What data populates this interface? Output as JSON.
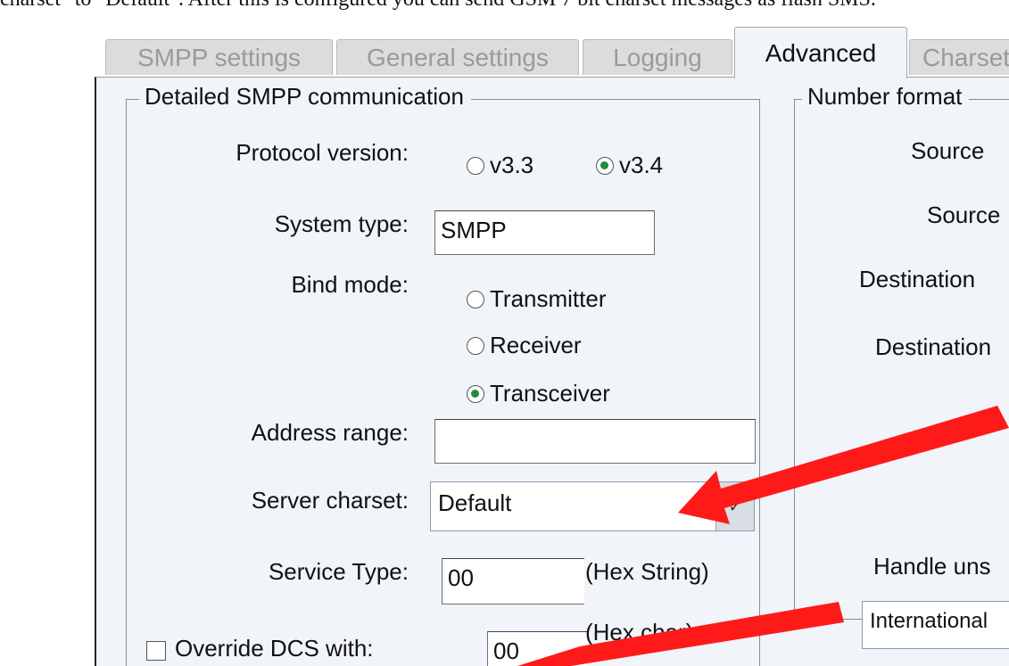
{
  "doc_text": "charset\" to \"Default\". After this is configured you can send GSM 7 bit charset messages as flash SMS.",
  "tabs": [
    {
      "label": "SMPP settings",
      "active": false
    },
    {
      "label": "General settings",
      "active": false
    },
    {
      "label": "Logging",
      "active": false
    },
    {
      "label": "Advanced",
      "active": true
    },
    {
      "label": "Charset",
      "active": false
    }
  ],
  "smpp_group": {
    "title": "Detailed SMPP communication",
    "protocol_label": "Protocol version:",
    "protocol_options": [
      {
        "label": "v3.3",
        "selected": false
      },
      {
        "label": "v3.4",
        "selected": true
      }
    ],
    "system_type_label": "System type:",
    "system_type_value": "SMPP",
    "bind_mode_label": "Bind mode:",
    "bind_modes": [
      {
        "label": "Transmitter",
        "selected": false
      },
      {
        "label": "Receiver",
        "selected": false
      },
      {
        "label": "Transceiver",
        "selected": true
      }
    ],
    "address_range_label": "Address range:",
    "address_range_value": "",
    "server_charset_label": "Server charset:",
    "server_charset_value": "Default",
    "service_type_label": "Service Type:",
    "service_type_value": "00",
    "service_type_hint": "(Hex String)",
    "override_dcs_label": "Override DCS with:",
    "override_dcs_checked": false,
    "override_dcs_value": "00",
    "override_dcs_hint": "(Hex char)"
  },
  "number_group": {
    "title": "Number format",
    "labels": [
      "Source",
      "Source",
      "Destination",
      "Destination"
    ],
    "handle_label": "Handle uns",
    "handle_value": "International"
  },
  "colors": {
    "panel_bg": "#f1f4f9",
    "annotation_arrow": "#ff1a1a",
    "radio_selected": "#1f8f3a"
  }
}
